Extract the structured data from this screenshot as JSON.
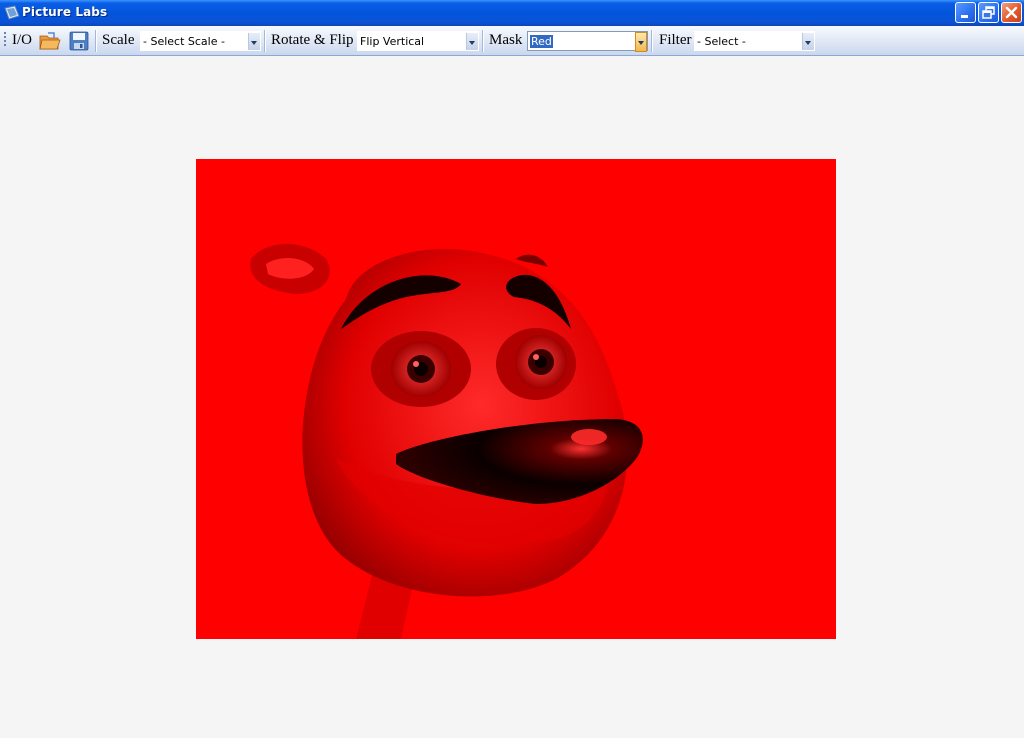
{
  "window": {
    "title": "Picture Labs"
  },
  "toolbar": {
    "io_label": "I/O",
    "open_icon": "open-folder-icon",
    "save_icon": "save-disk-icon",
    "scale": {
      "label": "Scale",
      "value": "- Select Scale -"
    },
    "rotate_flip": {
      "label": "Rotate & Flip",
      "value": "Flip Vertical"
    },
    "mask": {
      "label": "Mask",
      "value": "Red"
    },
    "filter": {
      "label": "Filter",
      "value": "- Select -"
    }
  },
  "canvas": {
    "mask_color": "#ff0000",
    "subject": "cartoon bear face"
  },
  "colors": {
    "titlebar": "#0354dc",
    "workspace": "#f5f5f5"
  }
}
